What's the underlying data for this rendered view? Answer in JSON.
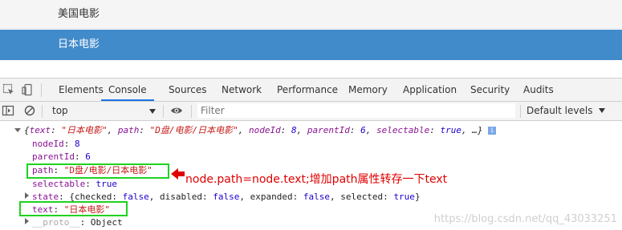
{
  "tree": {
    "items": [
      {
        "label": "美国电影",
        "selected": false
      },
      {
        "label": "日本电影",
        "selected": true
      }
    ],
    "selected_color": "#428bca"
  },
  "devtools": {
    "tabs": [
      {
        "label": "Elements",
        "active": false
      },
      {
        "label": "Console",
        "active": true
      },
      {
        "label": "Sources",
        "active": false
      },
      {
        "label": "Network",
        "active": false
      },
      {
        "label": "Performance",
        "active": false
      },
      {
        "label": "Memory",
        "active": false
      },
      {
        "label": "Application",
        "active": false
      },
      {
        "label": "Security",
        "active": false
      },
      {
        "label": "Audits",
        "active": false
      }
    ],
    "toolbar": {
      "context": "top",
      "filter_placeholder": "Filter",
      "levels": "Default levels"
    }
  },
  "console": {
    "summary": {
      "open": "{",
      "k1": "text",
      "v1": "\"日本电影\"",
      "k2": "path",
      "v2": "\"D盘/电影/日本电影\"",
      "k3": "nodeId",
      "v3": "8",
      "k4": "parentId",
      "v4": "6",
      "k5": "selectable",
      "v5": "true",
      "tail": "…}"
    },
    "props": {
      "nodeId": {
        "key": "nodeId",
        "value": "8"
      },
      "parentId": {
        "key": "parentId",
        "value": "6"
      },
      "path": {
        "key": "path",
        "value": "\"D盘/电影/日本电影\""
      },
      "selectable": {
        "key": "selectable",
        "value": "true"
      },
      "state": {
        "key": "state",
        "checked": "false",
        "disabled": "false",
        "expanded": "false",
        "selected": "true"
      },
      "text": {
        "key": "text",
        "value": "\"日本电影\""
      },
      "proto": {
        "key": "__proto__",
        "value": "Object"
      }
    }
  },
  "annotation": "node.path=node.text;增加path属性转存一下text",
  "watermark": "https://blog.csdn.net/qq_43033251",
  "colors": {
    "highlight_box": "#1fd21f",
    "annotation_text": "#e00000"
  }
}
